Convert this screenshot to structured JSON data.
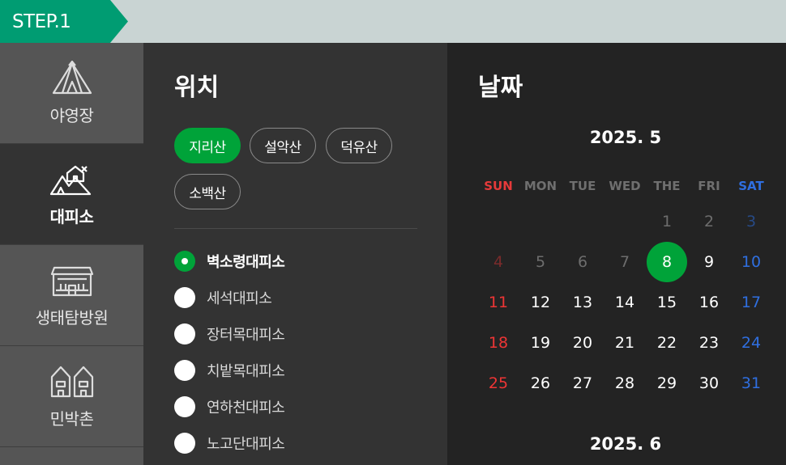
{
  "step": "STEP.1",
  "sidebar": {
    "items": [
      {
        "label": "야영장",
        "icon": "tent-icon",
        "active": false
      },
      {
        "label": "대피소",
        "icon": "shelter-icon",
        "active": true
      },
      {
        "label": "생태탐방원",
        "icon": "eco-center-icon",
        "active": false
      },
      {
        "label": "민박촌",
        "icon": "village-icon",
        "active": false
      }
    ]
  },
  "location": {
    "title": "위치",
    "chips": [
      {
        "label": "지리산",
        "active": true
      },
      {
        "label": "설악산",
        "active": false
      },
      {
        "label": "덕유산",
        "active": false
      },
      {
        "label": "소백산",
        "active": false
      }
    ],
    "shelters": [
      {
        "label": "벽소령대피소",
        "selected": true
      },
      {
        "label": "세석대피소",
        "selected": false
      },
      {
        "label": "장터목대피소",
        "selected": false
      },
      {
        "label": "치밭목대피소",
        "selected": false
      },
      {
        "label": "연하천대피소",
        "selected": false
      },
      {
        "label": "노고단대피소",
        "selected": false
      }
    ]
  },
  "date": {
    "title": "날짜",
    "month1": "2025. 5",
    "month2": "2025. 6",
    "weekdays": [
      "SUN",
      "MON",
      "TUE",
      "WED",
      "THE",
      "FRI",
      "SAT"
    ],
    "selected_day": 8,
    "today_index": 8,
    "first_weekday": 4,
    "days_in_month": 31
  },
  "colors": {
    "accent": "#00a339",
    "step": "#009c72",
    "sunday": "#ee3535",
    "saturday": "#2f6fe0"
  }
}
